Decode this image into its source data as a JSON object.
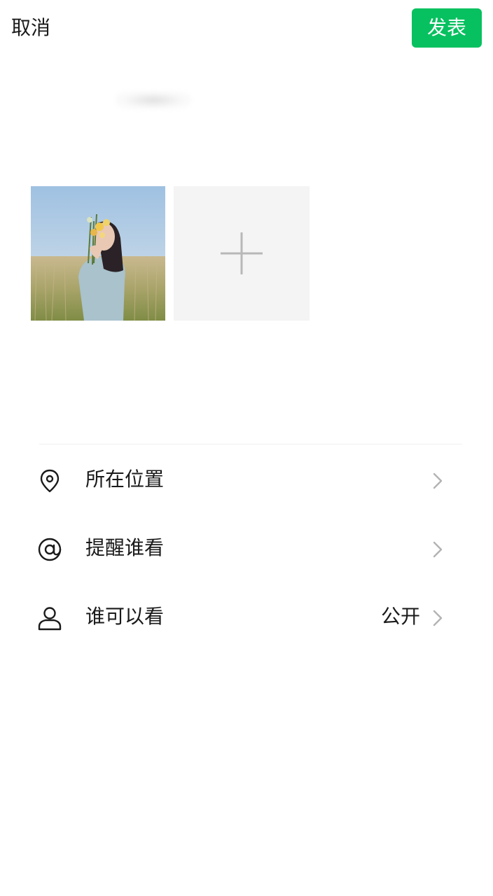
{
  "header": {
    "cancel_label": "取消",
    "publish_label": "发表",
    "publish_color": "#07c160"
  },
  "media": {
    "photo_description_icon": "photo-thumbnail",
    "add_icon": "plus-icon"
  },
  "options": [
    {
      "icon": "location-pin-icon",
      "label": "所在位置",
      "value": ""
    },
    {
      "icon": "at-icon",
      "label": "提醒谁看",
      "value": ""
    },
    {
      "icon": "person-icon",
      "label": "谁可以看",
      "value": "公开"
    }
  ]
}
